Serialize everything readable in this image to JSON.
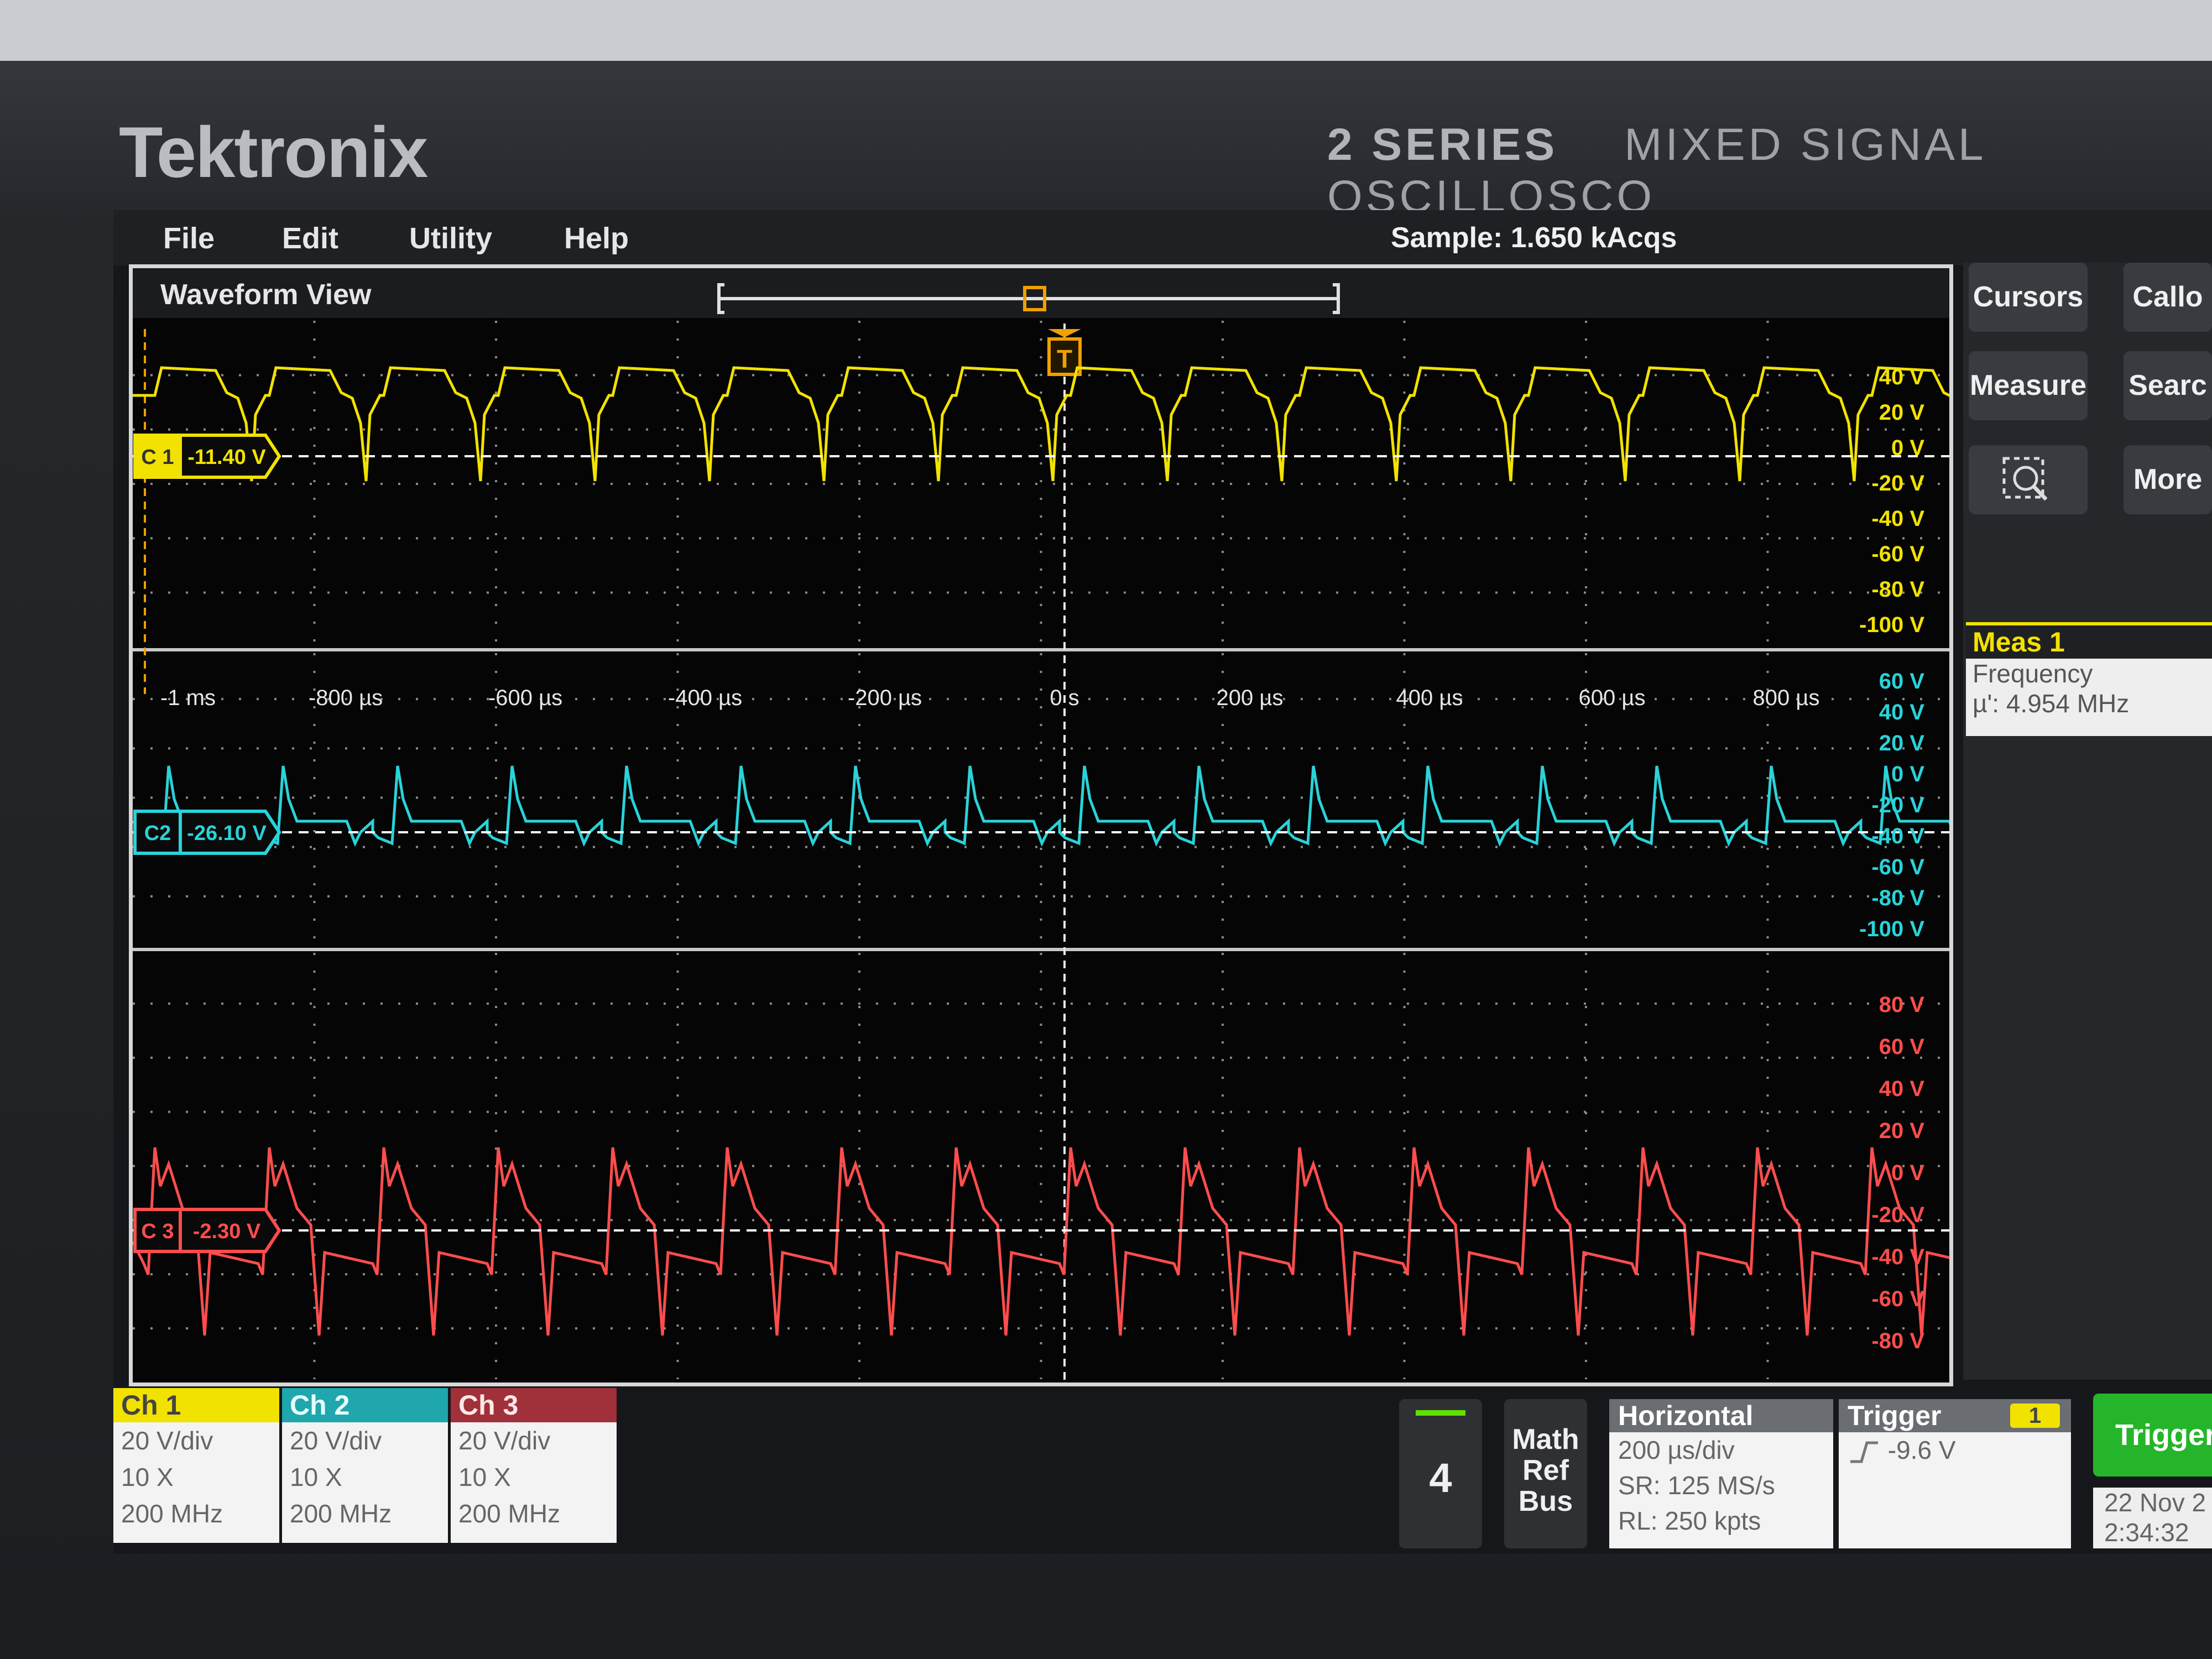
{
  "device": {
    "brand": "Tektronix",
    "series": "2 SERIES",
    "model": "MIXED SIGNAL OSCILLOSCO"
  },
  "menu": [
    "File",
    "Edit",
    "Utility",
    "Help"
  ],
  "acquisition": "Sample: 1.650 kAcqs",
  "waveform_view": {
    "title": "Waveform View",
    "trigger_marker": "T"
  },
  "time_ticks": [
    "-1 ms",
    "-800 µs",
    "-600 µs",
    "-400 µs",
    "-200 µs",
    "0 s",
    "200 µs",
    "400 µs",
    "600 µs",
    "800 µs"
  ],
  "ch1_scale_labels": [
    "40 V",
    "20 V",
    "0 V",
    "-20 V",
    "-40 V",
    "-60 V",
    "-80 V",
    "-100 V"
  ],
  "ch2_scale_labels": [
    "60 V",
    "40 V",
    "20 V",
    "0 V",
    "-20 V",
    "-40 V",
    "-60 V",
    "-80 V",
    "-100 V"
  ],
  "ch3_scale_labels": [
    "80 V",
    "60 V",
    "40 V",
    "20 V",
    "0 V",
    "-20 V",
    "-40 V",
    "-60 V",
    "-80 V"
  ],
  "channel_markers": [
    {
      "id": "C 1",
      "offset": "-11.40 V",
      "color": "#f2e200"
    },
    {
      "id": "C2",
      "offset": "-26.10 V",
      "color": "#29d3d9"
    },
    {
      "id": "C 3",
      "offset": "-2.30 V",
      "color": "#ff4d4d"
    }
  ],
  "side_buttons": [
    "Cursors",
    "Callo",
    "Measure",
    "Searc",
    "More"
  ],
  "side_zoom_icon": "zoom-icon",
  "measurement": {
    "header": "Meas 1",
    "name": "Frequency",
    "value": "µ': 4.954 MHz"
  },
  "channels": [
    {
      "name": "Ch 1",
      "vdiv": "20 V/div",
      "probe": "10 X",
      "bw": "200 MHz",
      "color": "#f2e200"
    },
    {
      "name": "Ch 2",
      "vdiv": "20 V/div",
      "probe": "10 X",
      "bw": "200 MHz",
      "color": "#1fa7ad"
    },
    {
      "name": "Ch 3",
      "vdiv": "20 V/div",
      "probe": "10 X",
      "bw": "200 MHz",
      "color": "#a0303a"
    }
  ],
  "add_channel": "4",
  "math_ref_bus": [
    "Math",
    "Ref",
    "Bus"
  ],
  "horizontal": {
    "title": "Horizontal",
    "scale": "200 µs/div",
    "sr": "SR: 125 MS/s",
    "rl": "RL: 250 kpts"
  },
  "trigger": {
    "title": "Trigger",
    "badge": "1",
    "level": "-9.6 V"
  },
  "run_button": "Trigger",
  "datetime": {
    "date": "22 Nov 2",
    "time": "2:34:32"
  }
}
